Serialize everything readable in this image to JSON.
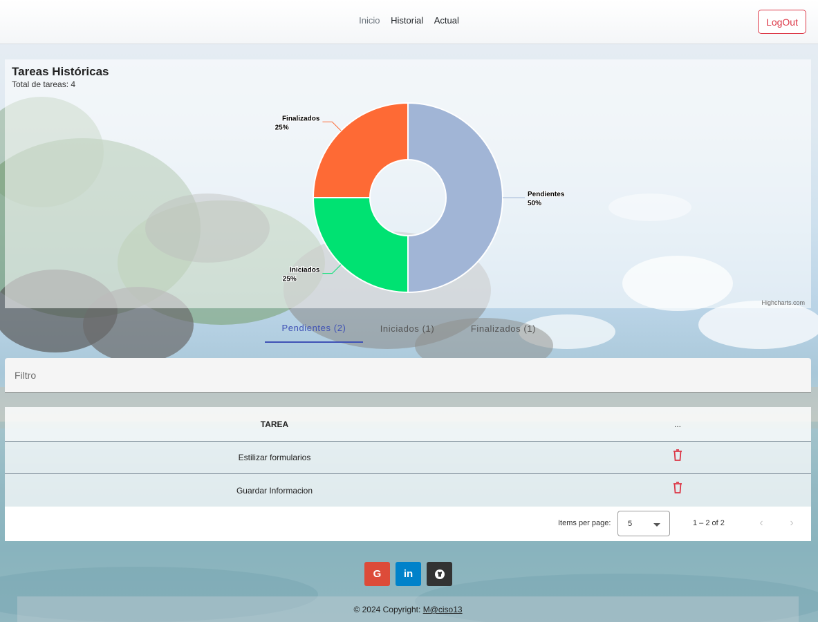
{
  "navbar": {
    "links": [
      "Inicio",
      "Historial",
      "Actual"
    ],
    "logout_label": "LogOut"
  },
  "chart_card": {
    "title": "Tareas Históricas",
    "subtitle": "Total de tareas: 4",
    "credits": "Highcharts.com"
  },
  "chart_data": {
    "type": "pie",
    "variant": "donut",
    "title": "Tareas Históricas",
    "subtitle": "Total de tareas: 4",
    "slices": [
      {
        "name": "Pendientes",
        "value": 50,
        "label": "50%",
        "color": "#a1b5d6"
      },
      {
        "name": "Iniciados",
        "value": 25,
        "label": "25%",
        "color": "#00e272"
      },
      {
        "name": "Finalizados",
        "value": 25,
        "label": "25%",
        "color": "#fe6a35"
      }
    ]
  },
  "tabs": [
    {
      "label": "Pendientes (2)",
      "active": true
    },
    {
      "label": "Iniciados (1)",
      "active": false
    },
    {
      "label": "Finalizados (1)",
      "active": false
    }
  ],
  "filter": {
    "placeholder": "Filtro"
  },
  "table": {
    "headers": [
      "TAREA",
      "..."
    ],
    "rows": [
      {
        "task": "Estilizar formularios",
        "action_icon": "trash-icon"
      },
      {
        "task": "Guardar Informacion",
        "action_icon": "trash-icon"
      }
    ]
  },
  "paginator": {
    "items_per_page_label": "Items per page:",
    "page_size": "5",
    "range_label": "1 – 2 of 2",
    "prev_icon": "chevron-left-icon",
    "next_icon": "chevron-right-icon"
  },
  "social": [
    {
      "icon": "google-icon",
      "glyph": "G",
      "color": "#dd4b39"
    },
    {
      "icon": "linkedin-icon",
      "glyph": "in",
      "color": "#0082ca"
    },
    {
      "icon": "github-icon",
      "glyph": "",
      "color": "#333333"
    }
  ],
  "footer": {
    "copyright": "© 2024 Copyright:",
    "author_link": "M@ciso13"
  },
  "colors": {
    "accent": "#3f51b5",
    "danger": "#dc3545"
  }
}
